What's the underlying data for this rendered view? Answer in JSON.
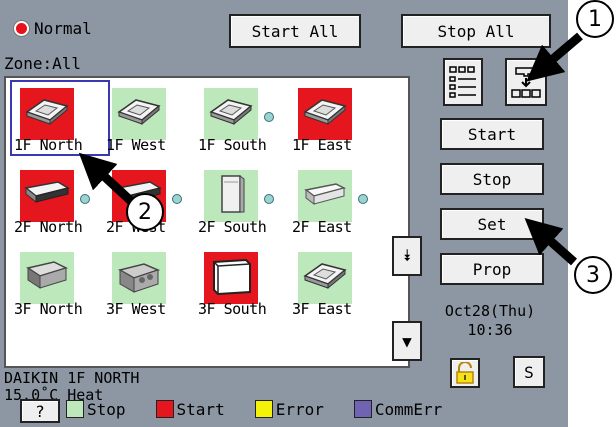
{
  "header": {
    "status_text": "Normal",
    "start_all": "Start All",
    "stop_all": "Stop All"
  },
  "zone_label": "Zone:All",
  "units": [
    {
      "label": "1F North",
      "state": "start",
      "icon": "ceiling-cassette-icon",
      "selected": true,
      "dot": false
    },
    {
      "label": "1F West",
      "state": "stop",
      "icon": "ceiling-cassette-icon",
      "selected": false,
      "dot": false
    },
    {
      "label": "1F South",
      "state": "stop",
      "icon": "ceiling-cassette-icon",
      "selected": false,
      "dot": true
    },
    {
      "label": "1F East",
      "state": "start",
      "icon": "ceiling-cassette-icon",
      "selected": false,
      "dot": false
    },
    {
      "label": "2F North",
      "state": "start",
      "icon": "ceiling-suspended-icon",
      "selected": false,
      "dot": true
    },
    {
      "label": "2F West",
      "state": "start",
      "icon": "ceiling-suspended-icon",
      "selected": false,
      "dot": true
    },
    {
      "label": "2F South",
      "state": "stop",
      "icon": "floor-standing-icon",
      "selected": false,
      "dot": true
    },
    {
      "label": "2F East",
      "state": "stop",
      "icon": "wall-mounted-icon",
      "selected": false,
      "dot": true
    },
    {
      "label": "3F North",
      "state": "stop",
      "icon": "duct-unit-icon",
      "selected": false,
      "dot": false
    },
    {
      "label": "3F West",
      "state": "stop",
      "icon": "ventilator-icon",
      "selected": false,
      "dot": false
    },
    {
      "label": "3F South",
      "state": "start",
      "icon": "floor-concealed-icon",
      "selected": false,
      "dot": false
    },
    {
      "label": "3F East",
      "state": "stop",
      "icon": "ceiling-cassette-icon",
      "selected": false,
      "dot": false
    }
  ],
  "info": {
    "line1": "DAIKIN 1F NORTH",
    "line2": "15.0˚C  Heat"
  },
  "side_buttons": {
    "start": "Start",
    "stop": "Stop",
    "set": "Set",
    "prop": "Prop"
  },
  "datetime": {
    "date": "Oct28(Thu)",
    "time": "10:36"
  },
  "s_button": "S",
  "help_button": "?",
  "legend": [
    {
      "label": "Stop",
      "color": "#bde8bc"
    },
    {
      "label": "Start",
      "color": "#e5161e"
    },
    {
      "label": "Error",
      "color": "#f5f20a"
    },
    {
      "label": "CommErr",
      "color": "#7163b4"
    }
  ],
  "callouts": [
    "1",
    "2",
    "3"
  ],
  "colors": {
    "panel": "#8c97a3",
    "start_red": "#e5161e",
    "stop_green": "#bde8bc",
    "selection": "#3a3ab0"
  }
}
